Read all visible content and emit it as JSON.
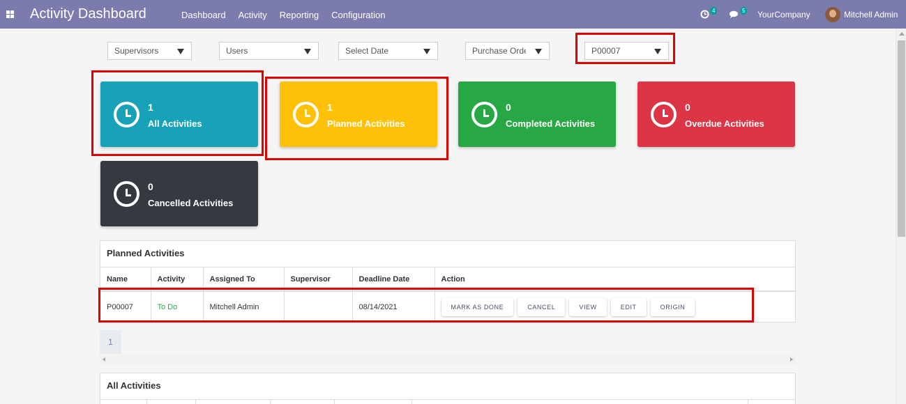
{
  "navbar": {
    "title": "Activity Dashboard",
    "menu": [
      "Dashboard",
      "Activity",
      "Reporting",
      "Configuration"
    ],
    "activity_count": "4",
    "message_count": "5",
    "company": "YourCompany",
    "user": "Mitchell Admin",
    "bg_color": "#7c7bad"
  },
  "filters": {
    "supervisors": "Supervisors",
    "users": "Users",
    "date": "Select Date",
    "model": "Purchase Order",
    "record": "P00007"
  },
  "cards": {
    "all": {
      "count": "1",
      "label": "All Activities",
      "color": "#17a2b8"
    },
    "planned": {
      "count": "1",
      "label": "Planned Activities",
      "color": "#ffc107"
    },
    "completed": {
      "count": "0",
      "label": "Completed Activities",
      "color": "#28a745"
    },
    "overdue": {
      "count": "0",
      "label": "Overdue Activities",
      "color": "#dc3545"
    },
    "cancelled": {
      "count": "0",
      "label": "Cancelled Activities",
      "color": "#343a40"
    }
  },
  "planned_table": {
    "title": "Planned Activities",
    "headers": [
      "Name",
      "Activity",
      "Assigned To",
      "Supervisor",
      "Deadline Date",
      "Action"
    ],
    "row": {
      "name": "P00007",
      "activity": "To Do",
      "assigned_to": "Mitchell Admin",
      "supervisor": "",
      "deadline": "08/14/2021"
    },
    "actions": [
      "MARK AS DONE",
      "CANCEL",
      "VIEW",
      "EDIT",
      "ORIGIN"
    ],
    "page": "1"
  },
  "all_table": {
    "title": "All Activities"
  }
}
